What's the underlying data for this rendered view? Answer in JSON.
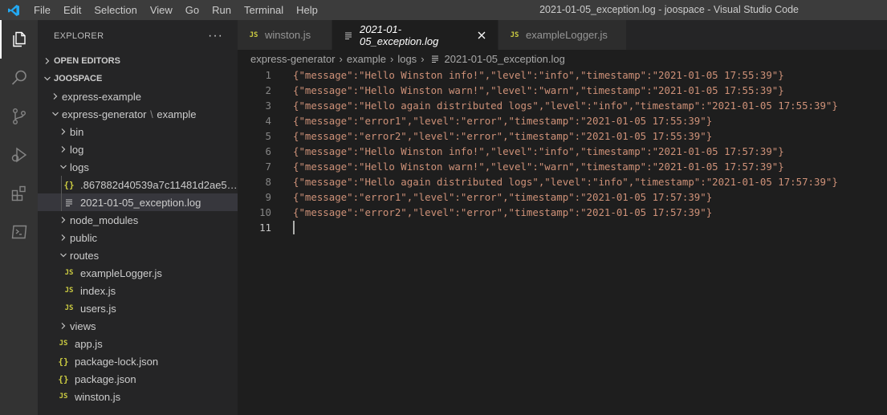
{
  "menu": [
    "File",
    "Edit",
    "Selection",
    "View",
    "Go",
    "Run",
    "Terminal",
    "Help"
  ],
  "window_title": "2021-01-05_exception.log - joospace - Visual Studio Code",
  "activity_bar": [
    "explorer-icon",
    "search-icon",
    "source-control-icon",
    "run-debug-icon",
    "extensions-icon",
    "remote-explorer-icon"
  ],
  "sidebar": {
    "title": "EXPLORER",
    "more": "···",
    "open_editors": "OPEN EDITORS",
    "workspace": "JOOSPACE",
    "tree": {
      "express_example": "express-example",
      "express_generator": "express-generator",
      "example": "example",
      "bin": "bin",
      "log": "log",
      "logs": "logs",
      "hash_json": ".867882d40539a7c11481d2ae58f...",
      "exception_log": "2021-01-05_exception.log",
      "node_modules": "node_modules",
      "public": "public",
      "routes": "routes",
      "example_logger": "exampleLogger.js",
      "index_js": "index.js",
      "users_js": "users.js",
      "views": "views",
      "app_js": "app.js",
      "package_lock": "package-lock.json",
      "package_json": "package.json",
      "winston_js": "winston.js"
    }
  },
  "tabs": [
    {
      "label": "winston.js",
      "icon": "js"
    },
    {
      "label": "2021-01-05_exception.log",
      "icon": "log",
      "active": true
    },
    {
      "label": "exampleLogger.js",
      "icon": "js"
    }
  ],
  "breadcrumb": [
    "express-generator",
    "example",
    "logs",
    "2021-01-05_exception.log"
  ],
  "editor": {
    "current_line": 11,
    "lines": [
      "{\"message\":\"Hello Winston info!\",\"level\":\"info\",\"timestamp\":\"2021-01-05 17:55:39\"}",
      "{\"message\":\"Hello Winston warn!\",\"level\":\"warn\",\"timestamp\":\"2021-01-05 17:55:39\"}",
      "{\"message\":\"Hello again distributed logs\",\"level\":\"info\",\"timestamp\":\"2021-01-05 17:55:39\"}",
      "{\"message\":\"error1\",\"level\":\"error\",\"timestamp\":\"2021-01-05 17:55:39\"}",
      "{\"message\":\"error2\",\"level\":\"error\",\"timestamp\":\"2021-01-05 17:55:39\"}",
      "{\"message\":\"Hello Winston info!\",\"level\":\"info\",\"timestamp\":\"2021-01-05 17:57:39\"}",
      "{\"message\":\"Hello Winston warn!\",\"level\":\"warn\",\"timestamp\":\"2021-01-05 17:57:39\"}",
      "{\"message\":\"Hello again distributed logs\",\"level\":\"info\",\"timestamp\":\"2021-01-05 17:57:39\"}",
      "{\"message\":\"error1\",\"level\":\"error\",\"timestamp\":\"2021-01-05 17:57:39\"}",
      "{\"message\":\"error2\",\"level\":\"error\",\"timestamp\":\"2021-01-05 17:57:39\"}",
      ""
    ]
  },
  "colors": {
    "titlebar": "#3c3c3c",
    "activitybar": "#333333",
    "sidebar": "#252526",
    "editor": "#1e1e1e",
    "string": "#ce9178",
    "js_icon": "#cbcb41",
    "vscode_blue": "#23a9f2"
  }
}
